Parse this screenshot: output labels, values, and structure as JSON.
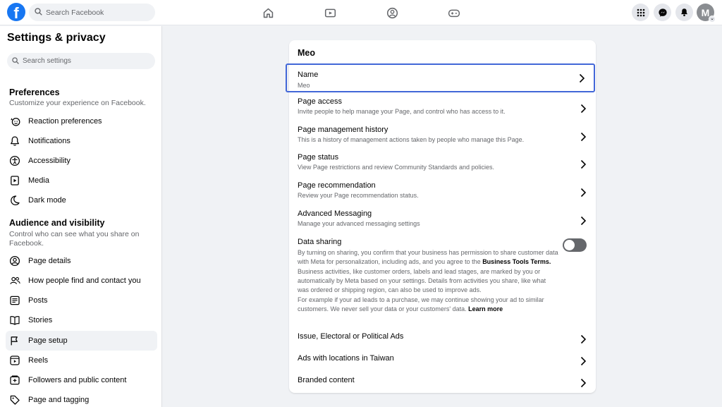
{
  "topbar": {
    "logo_letter": "f",
    "search_placeholder": "Search Facebook",
    "avatar_letter": "M",
    "avatar_badge": "⌄"
  },
  "sidebar": {
    "title": "Settings & privacy",
    "search_placeholder": "Search settings",
    "sections": [
      {
        "title": "Preferences",
        "subtitle": "Customize your experience on Facebook.",
        "items": [
          {
            "label": "Reaction preferences",
            "icon": "reaction-icon"
          },
          {
            "label": "Notifications",
            "icon": "bell-icon"
          },
          {
            "label": "Accessibility",
            "icon": "accessibility-icon"
          },
          {
            "label": "Media",
            "icon": "media-icon"
          },
          {
            "label": "Dark mode",
            "icon": "moon-icon"
          }
        ]
      },
      {
        "title": "Audience and visibility",
        "subtitle": "Control who can see what you share on Facebook.",
        "items": [
          {
            "label": "Page details",
            "icon": "person-icon"
          },
          {
            "label": "How people find and contact you",
            "icon": "people-icon"
          },
          {
            "label": "Posts",
            "icon": "posts-icon"
          },
          {
            "label": "Stories",
            "icon": "book-icon"
          },
          {
            "label": "Page setup",
            "icon": "flag-icon",
            "active": true
          },
          {
            "label": "Reels",
            "icon": "reels-icon"
          },
          {
            "label": "Followers and public content",
            "icon": "followers-icon"
          },
          {
            "label": "Page and tagging",
            "icon": "tag-icon"
          }
        ]
      }
    ]
  },
  "main": {
    "title": "Meo",
    "rows": [
      {
        "title": "Name",
        "subtitle": "Meo"
      },
      {
        "title": "Page access",
        "subtitle": "Invite people to help manage your Page, and control who has access to it."
      },
      {
        "title": "Page management history",
        "subtitle": "This is a history of management actions taken by people who manage this Page."
      },
      {
        "title": "Page status",
        "subtitle": "View Page restrictions and review Community Standards and policies."
      },
      {
        "title": "Page recommendation",
        "subtitle": "Review your Page recommendation status."
      },
      {
        "title": "Advanced Messaging",
        "subtitle": "Manage your advanced messaging settings"
      }
    ],
    "data_sharing": {
      "title": "Data sharing",
      "para1": "By turning on sharing, you confirm that your business has permission to share customer data with Meta for personalization, including ads, and you agree to the",
      "terms_link": "Business Tools Terms.",
      "para2": "Business activities, like customer orders, labels and lead stages, are marked by you or automatically by Meta based on your settings. Details from activities you share, like what was ordered or shipping region, can also be used to improve ads.",
      "para3": "For example if your ad leads to a purchase, we may continue showing your ad to similar customers. We never sell your data or your customers' data.",
      "learn_more": "Learn more",
      "toggle_on": false
    },
    "bottom_rows": [
      {
        "title": "Issue, Electoral or Political Ads"
      },
      {
        "title": "Ads with locations in Taiwan"
      },
      {
        "title": "Branded content"
      }
    ]
  },
  "colors": {
    "brand": "#1877f2",
    "focus_border": "#4267d8",
    "toggle_off": "#65676b"
  }
}
